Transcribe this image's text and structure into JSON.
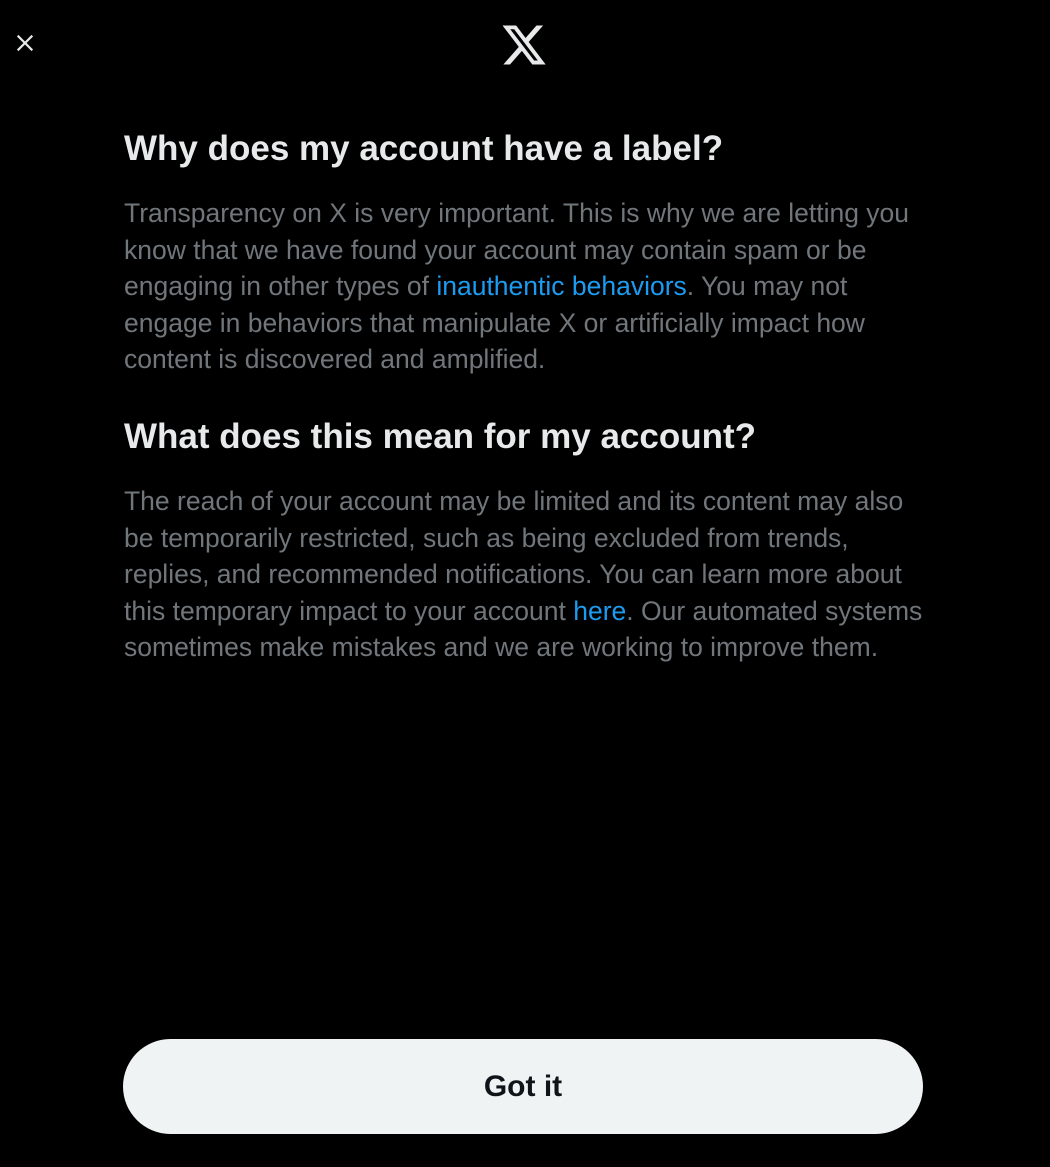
{
  "header": {
    "close_icon": "close-icon",
    "logo_icon": "x-logo-icon"
  },
  "section_one": {
    "heading": "Why does my account have a label?",
    "text_before_link": "Transparency on X is very important. This is why we are letting you know that we have found your account may contain spam or be engaging in other types of ",
    "link_text": "inauthentic behaviors",
    "text_after_link": ". You may not engage in behaviors that manipulate X or artificially impact how content is discovered and amplified."
  },
  "section_two": {
    "heading": "What does this mean for my account?",
    "text_before_link": "The reach of your account may be limited and its content may also be temporarily restricted, such as being excluded from trends, replies, and recommended notifications. You can learn more about this temporary impact to your account ",
    "link_text": "here",
    "text_after_link": ". Our automated systems sometimes make mistakes and we are working to improve them."
  },
  "footer": {
    "button_label": "Got it"
  },
  "colors": {
    "background": "#000000",
    "heading": "#e7e9ea",
    "body_text": "#71767b",
    "link": "#1d9bf0",
    "button_bg": "#eff3f4",
    "button_text": "#0f1419"
  }
}
